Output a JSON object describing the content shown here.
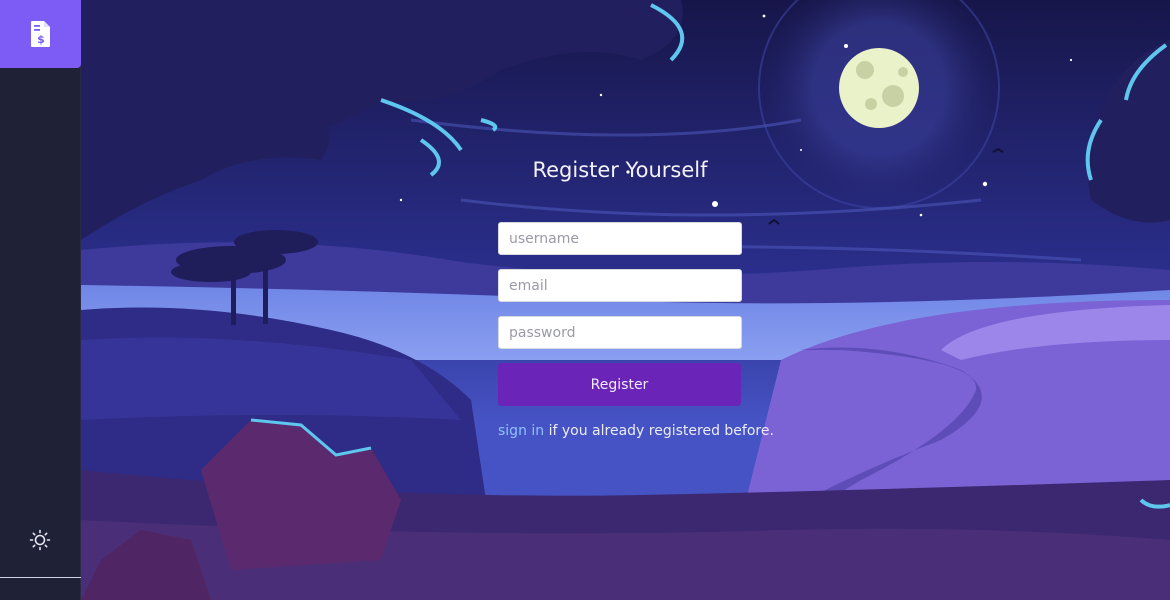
{
  "sidebar": {
    "logo_icon": "invoice-dollar-icon",
    "theme_icon": "sun-icon"
  },
  "form": {
    "title": "Register Yourself",
    "username_placeholder": "username",
    "email_placeholder": "email",
    "password_placeholder": "password",
    "submit_label": "Register",
    "signin_link": "sign in",
    "signin_suffix": " if you already registered before."
  },
  "colors": {
    "accent": "#7c5cf5",
    "button": "#6a24b8",
    "link": "#8fc3ff",
    "sidebar_bg": "#1f2137"
  }
}
